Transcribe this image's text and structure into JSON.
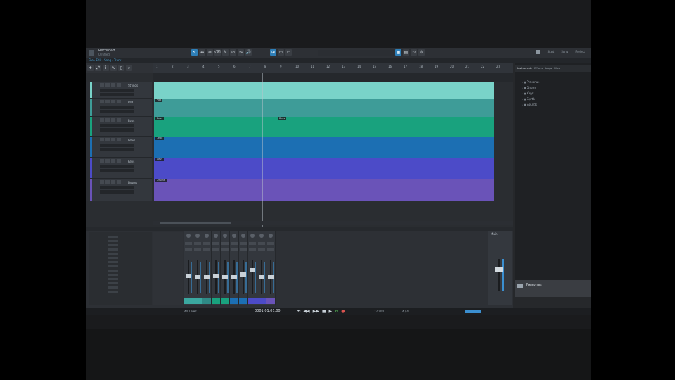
{
  "window": {
    "song_title": "Recorded",
    "song_subtitle": "Untitled",
    "breadcrumb": "File · Edit · Song · Track",
    "right_links": [
      "Start",
      "Song",
      "Project"
    ]
  },
  "toolbar": {
    "tools": [
      "arrow-tool-icon",
      "range-tool-icon",
      "split-tool-icon",
      "eraser-tool-icon",
      "paint-tool-icon",
      "mute-tool-icon",
      "bend-tool-icon",
      "listen-tool-icon"
    ],
    "active_tool_index": 0
  },
  "ruler": {
    "bars": [
      "1",
      "2",
      "3",
      "4",
      "5",
      "6",
      "7",
      "8",
      "9",
      "10",
      "11",
      "12",
      "13",
      "14",
      "15",
      "16",
      "17",
      "18",
      "19",
      "20",
      "21",
      "22",
      "23"
    ]
  },
  "tracks": [
    {
      "name": "Strings",
      "color": "#79d3c9",
      "clip_label": "",
      "clip_label2": "",
      "field1": "",
      "field2": ""
    },
    {
      "name": "Pad",
      "color": "#3e9c98",
      "clip_label": "Pad",
      "clip_label2": "",
      "field1": "",
      "field2": ""
    },
    {
      "name": "Bass",
      "color": "#19a27e",
      "clip_label": "Bass",
      "clip_label2": "Bass",
      "field1": "",
      "field2": ""
    },
    {
      "name": "Lead",
      "color": "#1c6fb3",
      "clip_label": "Lead",
      "clip_label2": "",
      "field1": "",
      "field2": ""
    },
    {
      "name": "Keys",
      "color": "#4c4bc8",
      "clip_label": "Keys",
      "clip_label2": "",
      "field1": "",
      "field2": ""
    },
    {
      "name": "Drums",
      "color": "#6a53b8",
      "clip_label": "Drums",
      "clip_label2": "",
      "field1": "",
      "field2": ""
    }
  ],
  "browser": {
    "tabs": [
      "Instruments",
      "Effects",
      "Loops",
      "Files"
    ],
    "items": [
      "Presonus",
      "Drums",
      "Keys",
      "Synth",
      "Sounds"
    ]
  },
  "mixer": {
    "instruments": [
      "",
      "",
      "",
      "",
      "",
      "",
      "",
      "",
      "",
      "",
      "",
      "",
      "",
      ""
    ],
    "channels": [
      {
        "level": 0.55,
        "label_color": "#3ba8a0"
      },
      {
        "level": 0.5,
        "label_color": "#3ba8a0"
      },
      {
        "level": 0.5,
        "label_color": "#2f8a86"
      },
      {
        "level": 0.55,
        "label_color": "#19a27e"
      },
      {
        "level": 0.5,
        "label_color": "#19a27e"
      },
      {
        "level": 0.5,
        "label_color": "#1c6fb3"
      },
      {
        "level": 0.6,
        "label_color": "#1c6fb3"
      },
      {
        "level": 0.75,
        "label_color": "#4c4bc8"
      },
      {
        "level": 0.5,
        "label_color": "#4c4bc8"
      },
      {
        "level": 0.5,
        "label_color": "#6a53b8"
      }
    ],
    "main_label": "Main"
  },
  "transport": {
    "sample_rate": "44.1 kHz",
    "record_max": "",
    "time": "0001.01.01.00",
    "tempo": "120.00",
    "signature": "4 / 4"
  },
  "notification": {
    "title": "Presonus",
    "body": ""
  },
  "colors": {
    "accent": "#2e7fb8",
    "record": "#d9534f",
    "loop": "#5fd35f"
  }
}
